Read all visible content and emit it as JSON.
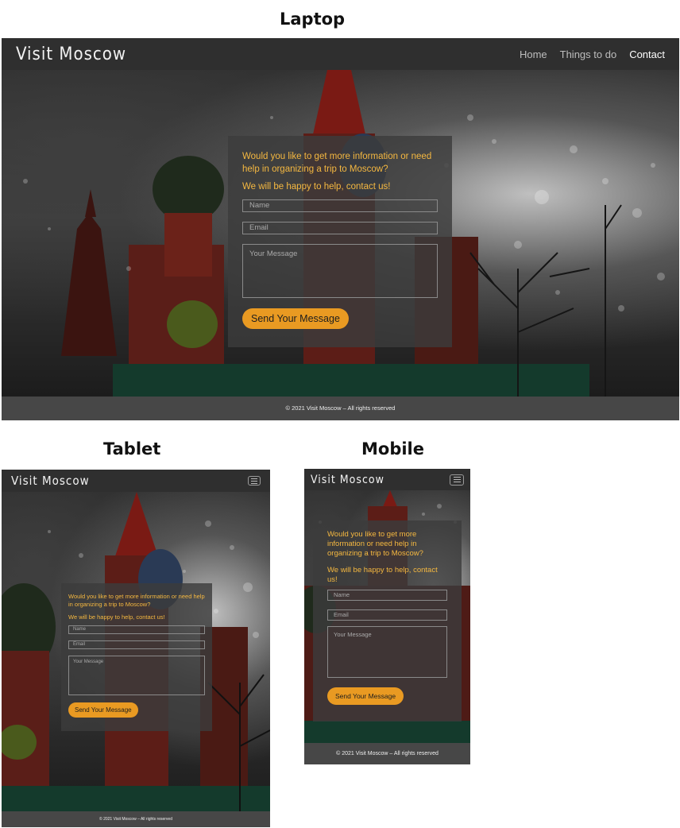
{
  "labels": {
    "laptop": "Laptop",
    "tablet": "Tablet",
    "mobile": "Mobile"
  },
  "brand": "Visit Moscow",
  "nav": {
    "home": "Home",
    "things": "Things to do",
    "contact": "Contact"
  },
  "form": {
    "intro": "Would you like to get more information or need help in organizing a trip to Moscow?",
    "cta": "We will be happy to help, contact us!",
    "name_placeholder": "Name",
    "email_placeholder": "Email",
    "message_placeholder": "Your Message",
    "submit": "Send Your Message"
  },
  "footer": "© 2021 Visit Moscow – All rights reserved",
  "colors": {
    "accent": "#e99a22",
    "heading_text": "#f5b840",
    "nav_bg": "#2f2f2f",
    "footer_bg": "#474747"
  },
  "icons": {
    "menu": "hamburger-menu-icon"
  }
}
